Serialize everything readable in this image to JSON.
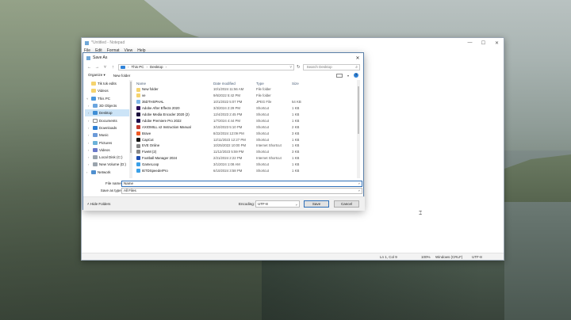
{
  "notepad": {
    "title": "*Untitled - Notepad",
    "menu": [
      "File",
      "Edit",
      "Format",
      "View",
      "Help"
    ],
    "status": {
      "position": "Ln 1, Col 9",
      "zoom": "100%",
      "line_endings": "Windows (CRLF)",
      "encoding": "UTF-8"
    }
  },
  "dialog": {
    "title": "Save As",
    "breadcrumb": [
      "This PC",
      "Desktop"
    ],
    "search_placeholder": "Search Desktop",
    "organize_label": "Organize ▾",
    "new_folder_label": "New folder",
    "columns": [
      "Name",
      "Date modified",
      "Type",
      "Size"
    ],
    "nav_items": [
      {
        "label": "Tik tok edits",
        "icon": "folder-icon"
      },
      {
        "label": "Videos",
        "icon": "folder-icon"
      },
      {
        "label": "This PC",
        "icon": "pc-icon"
      },
      {
        "label": "3D Objects",
        "icon": "cube-icon"
      },
      {
        "label": "Desktop",
        "icon": "desktop-icon",
        "selected": true
      },
      {
        "label": "Documents",
        "icon": "documents-icon"
      },
      {
        "label": "Downloads",
        "icon": "downloads-icon"
      },
      {
        "label": "Music",
        "icon": "music-icon"
      },
      {
        "label": "Pictures",
        "icon": "pictures-icon"
      },
      {
        "label": "Videos",
        "icon": "videos-icon"
      },
      {
        "label": "Local Disk (C:)",
        "icon": "disk-icon"
      },
      {
        "label": "New Volume (D:)",
        "icon": "disk-icon"
      },
      {
        "label": "Network",
        "icon": "network-icon"
      }
    ],
    "files": [
      {
        "name": "New folder",
        "date": "10/1/2024 11:56 AM",
        "type": "File folder",
        "size": ""
      },
      {
        "name": "ve",
        "date": "9/6/2022 5:42 PM",
        "type": "File folder",
        "size": ""
      },
      {
        "name": "35DTHSPHAL",
        "date": "10/1/2022 5:07 PM",
        "type": "JPEG File",
        "size": "54 KB"
      },
      {
        "name": "Adobe After Effects 2020",
        "date": "3/3/2024 2:29 PM",
        "type": "Shortcut",
        "size": "1 KB"
      },
      {
        "name": "Adobe Media Encoder 2020 (2)",
        "date": "12/4/2023 2:45 PM",
        "type": "Shortcut",
        "size": "1 KB"
      },
      {
        "name": "Adobe Premiere Pro 2022",
        "date": "1/7/2024 4:44 PM",
        "type": "Shortcut",
        "size": "1 KB"
      },
      {
        "name": "AXIOMILL v2 Instruction Manual",
        "date": "3/10/2023 5:10 PM",
        "type": "Shortcut",
        "size": "2 KB"
      },
      {
        "name": "Brave",
        "date": "8/22/2024 12:09 PM",
        "type": "Shortcut",
        "size": "3 KB"
      },
      {
        "name": "CapCut",
        "date": "12/11/2023 12:27 PM",
        "type": "Shortcut",
        "size": "1 KB"
      },
      {
        "name": "EVE Online",
        "date": "10/25/2022 10:00 PM",
        "type": "Internet Shortcut",
        "size": "1 KB"
      },
      {
        "name": "FiveM (2)",
        "date": "11/12/2023 5:59 PM",
        "type": "Shortcut",
        "size": "3 KB"
      },
      {
        "name": "Football Manager 2024",
        "date": "2/21/2024 2:22 PM",
        "type": "Internet Shortcut",
        "size": "1 KB"
      },
      {
        "name": "GameLoop",
        "date": "3/1/2024 1:08 AM",
        "type": "Shortcut",
        "size": "1 KB"
      },
      {
        "name": "IETDSpeederPro",
        "date": "6/10/2024 3:58 PM",
        "type": "Shortcut",
        "size": "1 KB"
      }
    ],
    "file_name_label": "File name:",
    "file_name_value": "Name",
    "save_as_type_label": "Save as type:",
    "save_as_type_value": "All Files",
    "hide_folders_label": "Hide Folders",
    "encoding_label": "Encoding:",
    "encoding_value": "UTF-8",
    "save_label": "Save",
    "cancel_label": "Cancel"
  }
}
